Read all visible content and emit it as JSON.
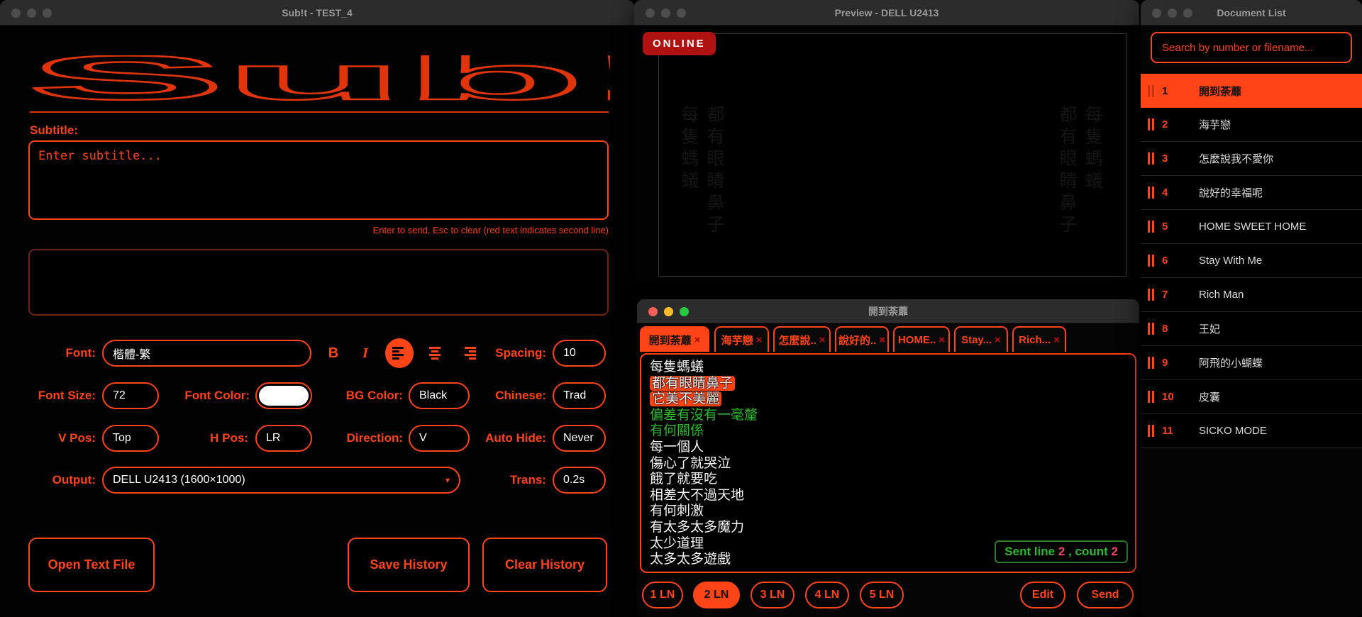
{
  "colors": {
    "accent": "#ff4417",
    "green": "#2db92d",
    "pink": "#f4486b",
    "online_red": "#b01212"
  },
  "main_window": {
    "title": "Sub!t - TEST_4",
    "logo_text": "Sub!t",
    "subtitle_label": "Subtitle:",
    "subtitle_placeholder": "Enter subtitle...",
    "hint": "Enter to send, Esc to clear (red text indicates second line)",
    "font_row": {
      "font_label": "Font:",
      "font_value": "楷體-繁",
      "bold_label": "B",
      "italic_label": "I",
      "spacing_label": "Spacing:",
      "spacing_value": "10"
    },
    "style_row": {
      "font_size_label": "Font Size:",
      "font_size_value": "72",
      "font_color_label": "Font Color:",
      "bg_color_label": "BG Color:",
      "bg_color_value": "Black",
      "chinese_label": "Chinese:",
      "chinese_value": "Trad"
    },
    "position_row": {
      "v_pos_label": "V Pos:",
      "v_pos_value": "Top",
      "h_pos_label": "H Pos:",
      "h_pos_value": "LR",
      "direction_label": "Direction:",
      "direction_value": "V",
      "auto_hide_label": "Auto Hide:",
      "auto_hide_value": "Never"
    },
    "output_row": {
      "output_label": "Output:",
      "output_value": "DELL U2413 (1600×1000)",
      "dropdown_arrow": "▾",
      "trans_label": "Trans:",
      "trans_value": "0.2s"
    },
    "buttons": {
      "open_text_file": "Open Text File",
      "save_history": "Save History",
      "clear_history": "Clear History"
    }
  },
  "preview_window": {
    "title": "Preview - DELL U2413",
    "online_badge": "ONLINE",
    "ghost_columns": {
      "left_outer": "每隻螞蟻",
      "left_inner": "都有眼睛鼻子",
      "right_inner": "都有眼睛鼻子",
      "right_outer": "每隻螞蟻"
    }
  },
  "editor_window": {
    "title": "開到荼蘼",
    "close_glyph": "×",
    "tabs": [
      {
        "label": "開到荼蘼",
        "active": true
      },
      {
        "label": "海芋戀"
      },
      {
        "label": "怎麼說.."
      },
      {
        "label": "說好的.."
      },
      {
        "label": "HOME.."
      },
      {
        "label": "Stay..."
      },
      {
        "label": "Rich..."
      }
    ],
    "lines": [
      {
        "text": "每隻螞蟻",
        "style": "normal"
      },
      {
        "text": "都有眼睛鼻子",
        "style": "highlight"
      },
      {
        "text": "它美不美麗",
        "style": "highlight"
      },
      {
        "text": "偏差有沒有一毫釐",
        "style": "green"
      },
      {
        "text": "有何關係",
        "style": "green"
      },
      {
        "text": "每一個人",
        "style": "normal"
      },
      {
        "text": "傷心了就哭泣",
        "style": "normal"
      },
      {
        "text": "餓了就要吃",
        "style": "normal"
      },
      {
        "text": "相差大不過天地",
        "style": "normal"
      },
      {
        "text": "有何刺激",
        "style": "normal"
      },
      {
        "text": "有太多太多魔力",
        "style": "normal"
      },
      {
        "text": "太少道理",
        "style": "normal"
      },
      {
        "text": "太多太多遊戲",
        "style": "normal"
      }
    ],
    "status": {
      "prefix": "Sent line",
      "line_number": "2",
      "separator": ", count",
      "count": "2"
    },
    "ln_buttons": [
      {
        "label": "1 LN"
      },
      {
        "label": "2 LN",
        "active": true
      },
      {
        "label": "3 LN"
      },
      {
        "label": "4 LN"
      },
      {
        "label": "5 LN"
      }
    ],
    "edit_button": "Edit",
    "send_button": "Send"
  },
  "document_window": {
    "title": "Document List",
    "search_placeholder": "Search by number or filename...",
    "items": [
      {
        "num": "1",
        "title": "開到荼蘼",
        "selected": true
      },
      {
        "num": "2",
        "title": "海芋戀"
      },
      {
        "num": "3",
        "title": "怎麼說我不愛你"
      },
      {
        "num": "4",
        "title": "說好的幸福呢"
      },
      {
        "num": "5",
        "title": "HOME SWEET HOME"
      },
      {
        "num": "6",
        "title": "Stay With Me"
      },
      {
        "num": "7",
        "title": "Rich Man"
      },
      {
        "num": "8",
        "title": "王妃"
      },
      {
        "num": "9",
        "title": "阿飛的小蝴蝶"
      },
      {
        "num": "10",
        "title": "皮囊"
      },
      {
        "num": "11",
        "title": "SICKO MODE"
      }
    ]
  }
}
